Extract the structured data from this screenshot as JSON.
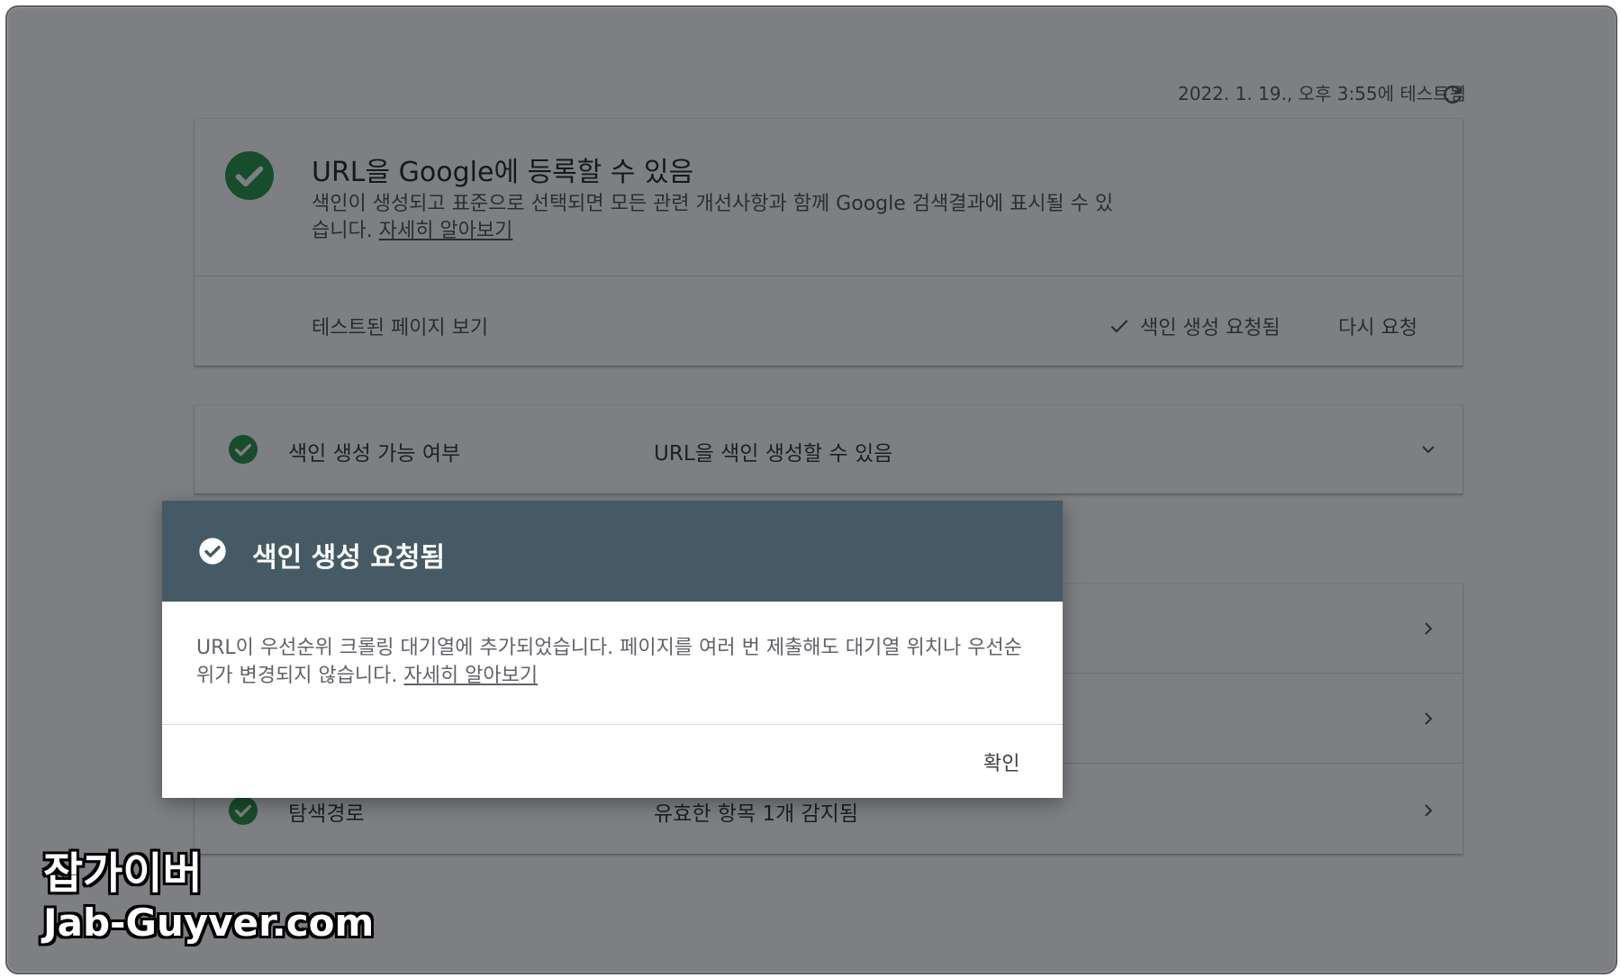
{
  "header": {
    "tested_text": "2022. 1. 19., 오후 3:55에 테스트됨",
    "refresh_icon": "refresh-icon"
  },
  "status_card": {
    "title": "URL을 Google에 등록할 수 있음",
    "description": "색인이 생성되고 표준으로 선택되면 모든 관련 개선사항과 함께 Google 검색결과에 표시될 수 있습니다.",
    "learn_more": "자세히 알아보기",
    "view_tested_page": "테스트된 페이지 보기",
    "indexing_requested": "색인 생성 요청됨",
    "request_again": "다시 요청"
  },
  "indexability": {
    "label": "색인 생성 가능 여부",
    "value": "URL을 색인 생성할 수 있음"
  },
  "enhancements": {
    "rows": [
      {
        "label": "",
        "value": ""
      },
      {
        "label": "",
        "value": ""
      },
      {
        "label": "탐색경로",
        "value": "유효한 항목 1개 감지됨"
      }
    ]
  },
  "dialog": {
    "title": "색인 생성 요청됨",
    "body": "URL이 우선순위 크롤링 대기열에 추가되었습니다. 페이지를 여러 번 제출해도 대기열 위치나 우선순위가 변경되지 않습니다.",
    "learn_more": "자세히 알아보기",
    "ok_button": "확인"
  },
  "watermark": {
    "line1": "잡가이버",
    "line2": "Jab-Guyver.com"
  },
  "colors": {
    "success_green": "#1e8e3e",
    "dialog_header": "#455a64"
  }
}
